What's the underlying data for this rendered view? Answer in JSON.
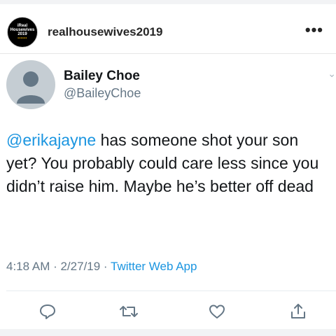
{
  "instagram": {
    "username": "realhousewives2019",
    "more_icon": "more-horizontal-icon",
    "avatar_text": [
      "iReal",
      "Housewives",
      "2019"
    ]
  },
  "tweet": {
    "author_name": "Bailey Choe",
    "author_handle": "@BaileyChoe",
    "mention": "@erikajayne",
    "text": " has someone shot your son yet? You probably could care less since you didn’t raise him. Maybe he’s better off dead",
    "time_date": "4:18 AM · 2/27/19 · ",
    "source_app": "Twitter Web App"
  },
  "actions": {
    "reply_icon": "reply-icon",
    "retweet_icon": "retweet-icon",
    "like_icon": "heart-icon",
    "share_icon": "share-icon"
  },
  "colors": {
    "link": "#1b95e0",
    "secondary_text": "#657786",
    "primary_text": "#14171a"
  }
}
